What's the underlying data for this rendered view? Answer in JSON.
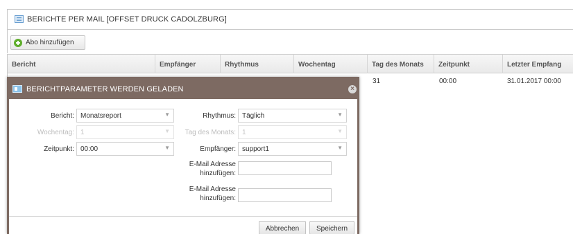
{
  "panel": {
    "title": "BERICHTE PER MAIL [OFFSET DRUCK CADOLZBURG]"
  },
  "toolbar": {
    "add_label": "Abo hinzufügen"
  },
  "grid": {
    "columns": [
      "Bericht",
      "Empfänger",
      "Rhythmus",
      "Wochentag",
      "Tag des Monats",
      "Zeitpunkt",
      "Letzter Empfang"
    ],
    "row": {
      "tag_des_monats": "31",
      "zeitpunkt": "00:00",
      "letzter_empfang": "31.01.2017 00:00"
    }
  },
  "dialog": {
    "title": "BERICHTPARAMETER WERDEN GELADEN",
    "close_symbol": "×",
    "bericht_label": "Bericht:",
    "bericht_value": "Monatsreport",
    "rhythmus_label": "Rhythmus:",
    "rhythmus_value": "Täglich",
    "wochentag_label": "Wochentag:",
    "wochentag_value": "1",
    "tag_label": "Tag des Monats:",
    "tag_value": "1",
    "zeitpunkt_label": "Zeitpunkt:",
    "zeitpunkt_value": "00:00",
    "empfaenger_label": "Empfänger:",
    "empfaenger_value": "support1",
    "email_label_1_line1": "E-Mail Adresse",
    "email_label_1_line2": "hinzufügen:",
    "email_label_2_line1": "E-Mail Adresse",
    "email_label_2_line2": "hinzufügen:",
    "email_value_1": "",
    "email_value_2": "",
    "cancel_label": "Abbrechen",
    "save_label": "Speichern",
    "dropdown_arrow": "▼"
  },
  "colors": {
    "dialog_frame": "#7d6a62",
    "add_icon": "#5fae2c"
  }
}
